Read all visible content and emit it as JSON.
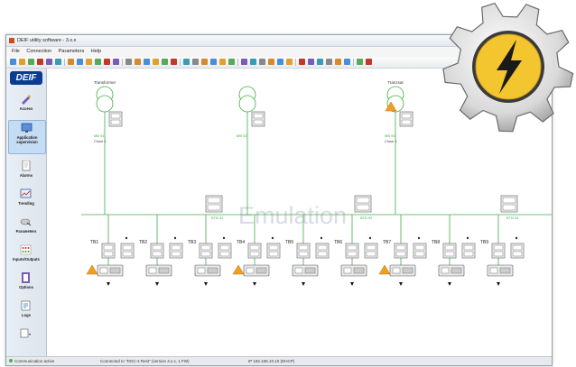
{
  "window": {
    "title": "DEIF utility software - 3.x.x"
  },
  "menu": [
    "File",
    "Connection",
    "Parameters",
    "Help"
  ],
  "sidebar": {
    "logo": "DEIF",
    "items": [
      {
        "label": "Access",
        "icon": "pen-icon"
      },
      {
        "label": "Application supervision",
        "icon": "monitor-icon"
      },
      {
        "label": "Alarms",
        "icon": "alarm-doc-icon"
      },
      {
        "label": "Trending",
        "icon": "trend-icon"
      },
      {
        "label": "Parameters",
        "icon": "parameters-icon"
      },
      {
        "label": "Inputs/Outputs",
        "icon": "io-icon"
      },
      {
        "label": "Options",
        "icon": "options-icon"
      },
      {
        "label": "Logs",
        "icon": "logs-icon"
      }
    ]
  },
  "diagram": {
    "watermark": "Emulation",
    "transformers": [
      {
        "label": "Transformer"
      },
      {
        "label": ""
      },
      {
        "label": "Tranzsat"
      }
    ],
    "mains_labels": [
      {
        "name": "MB 91",
        "sub": "Close 1"
      },
      {
        "name": "MB 92",
        "sub": ""
      },
      {
        "name": "MB 93",
        "sub": "Close 1"
      }
    ],
    "bus_tie_labels": [
      "BTB 91",
      "BTB 92",
      "BTB 93"
    ],
    "gensets": [
      "TB1",
      "TB2",
      "TB3",
      "TB4",
      "TB5",
      "TB6",
      "TB7",
      "TB8",
      "TB9"
    ]
  },
  "status": {
    "left": "Communication active",
    "connection": "Connected to \"DGC-4 Rest\" (version 4.x.x, 1 FW)",
    "ip": "IP 192.168.10.10 (DHCP)"
  },
  "colors": {
    "bus": "#3cb043",
    "accent": "#0a3d91",
    "gear_face": "#f3c52e"
  }
}
